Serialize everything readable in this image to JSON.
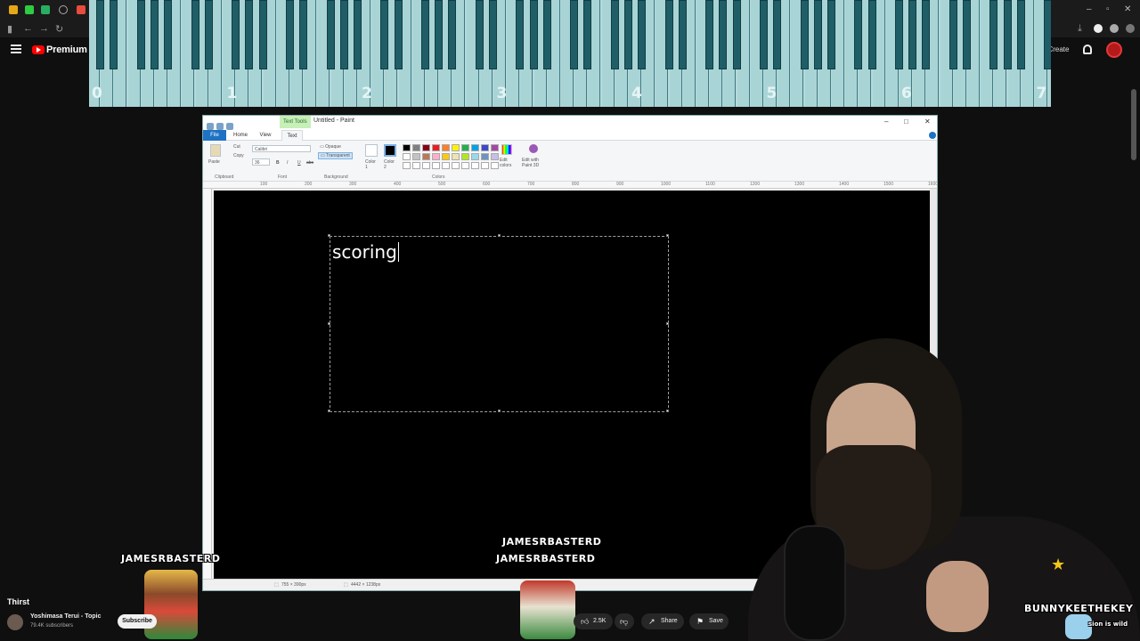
{
  "browser": {
    "colors": {
      "tab_green": "#2ecc40",
      "tab_red": "#e74c3c"
    }
  },
  "youtube": {
    "brand": "Premium",
    "create_label": "Create",
    "song_title": "Thirst",
    "channel_name": "Yoshimasa Terui - Topic",
    "channel_subs": "79.4K subscribers",
    "subscribe_label": "Subscribe",
    "like_count": "2.5K",
    "share_label": "Share",
    "save_label": "Save"
  },
  "piano": {
    "octave_labels": [
      "0",
      "1",
      "2",
      "3",
      "4",
      "5",
      "6",
      "7"
    ]
  },
  "paint": {
    "contextual_tab": "Text Tools",
    "window_title": "Untitled - Paint",
    "tabs": [
      "File",
      "Home",
      "View",
      "Text"
    ],
    "active_tab": "Text",
    "clipboard": {
      "paste": "Paste",
      "cut": "Cut",
      "copy": "Copy",
      "group": "Clipboard"
    },
    "font": {
      "family": "Calibri",
      "size": "36",
      "group": "Font",
      "styles": [
        "B",
        "I",
        "U",
        "abc"
      ]
    },
    "background": {
      "opaque": "Opaque",
      "transparent": "Transparent",
      "group": "Background"
    },
    "colors_group": "Colors",
    "color1_label": "Color 1",
    "color2_label": "Color 2",
    "edit_colors": "Edit colors",
    "edit_paint3d": "Edit with Paint 3D",
    "palette": [
      "#000000",
      "#7f7f7f",
      "#880015",
      "#ed1c24",
      "#ff7f27",
      "#fff200",
      "#22b14c",
      "#00a2e8",
      "#3f48cc",
      "#a349a4",
      "#ffffff",
      "#c3c3c3",
      "#b97a57",
      "#ffaec9",
      "#ffc90e",
      "#efe4b0",
      "#b5e61d",
      "#99d9ea",
      "#7092be",
      "#c8bfe7"
    ],
    "ruler_marks": [
      "100",
      "200",
      "300",
      "400",
      "500",
      "600",
      "700",
      "800",
      "900",
      "1000",
      "1100",
      "1200",
      "1300",
      "1400",
      "1500",
      "1600"
    ],
    "canvas_text": "scoring",
    "status_selection": "755 × 390px",
    "status_size": "4442 × 1238px"
  },
  "overlays": {
    "name_left": "JAMESRBASTERD",
    "name_center_top": "JAMESRBASTERD",
    "name_center_bottom": "JAMESRBASTERD",
    "name_right": "BUNNYKEETHEKEY",
    "caption_partial": "sion is wild"
  }
}
